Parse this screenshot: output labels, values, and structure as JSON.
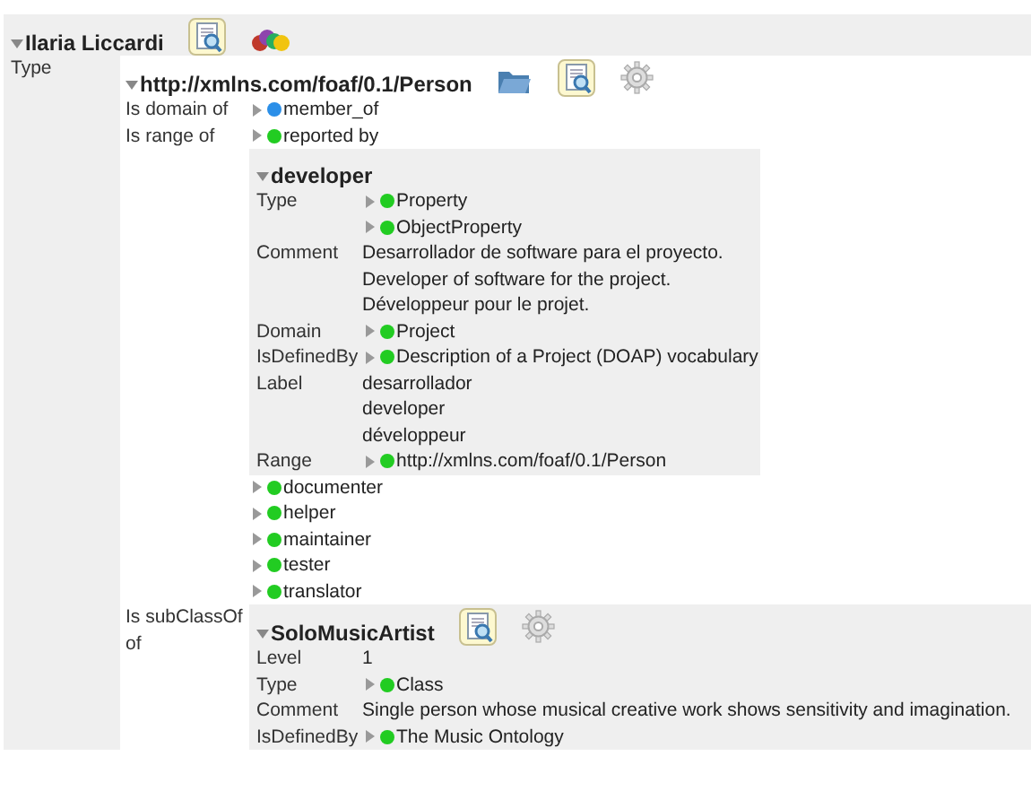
{
  "resource": {
    "title": "Ilaria Liccardi",
    "expanded": true,
    "inspect_button": true,
    "people_button": true,
    "rows": [
      {
        "label": "Type",
        "values": [
          {
            "kind": "resource",
            "title": "http://xmlns.com/foaf/0.1/Person",
            "expanded": true,
            "folder_button": true,
            "inspect_button": true,
            "settings_button": true,
            "rows": [
              {
                "label": "Is domain of",
                "values": [
                  {
                    "kind": "link",
                    "text": "member_of",
                    "expanded": false,
                    "color": "#2b8fe8"
                  }
                ]
              },
              {
                "label": "Is range of",
                "values": [
                  {
                    "kind": "link",
                    "text": "reported by",
                    "expanded": false,
                    "color": "#22cc22"
                  },
                  {
                    "kind": "resource",
                    "title": "developer",
                    "expanded": true,
                    "rows": [
                      {
                        "label": "Type",
                        "values": [
                          {
                            "kind": "link",
                            "text": "Property",
                            "expanded": false,
                            "color": "#22cc22"
                          },
                          {
                            "kind": "link",
                            "text": "ObjectProperty",
                            "expanded": false,
                            "color": "#22cc22"
                          }
                        ]
                      },
                      {
                        "label": "Comment",
                        "values": [
                          {
                            "kind": "text",
                            "text": "Desarrollador de software para el proyecto."
                          },
                          {
                            "kind": "text",
                            "text": "Developer of software for the project."
                          },
                          {
                            "kind": "text",
                            "text": "Développeur pour le projet."
                          }
                        ]
                      },
                      {
                        "label": "Domain",
                        "values": [
                          {
                            "kind": "link",
                            "text": "Project",
                            "expanded": false,
                            "color": "#22cc22"
                          }
                        ]
                      },
                      {
                        "label": "IsDefinedBy",
                        "values": [
                          {
                            "kind": "link",
                            "text": "Description of a Project (DOAP) vocabulary",
                            "expanded": false,
                            "color": "#22cc22"
                          }
                        ]
                      },
                      {
                        "label": "Label",
                        "values": [
                          {
                            "kind": "text",
                            "text": "desarrollador"
                          },
                          {
                            "kind": "text",
                            "text": "developer"
                          },
                          {
                            "kind": "text",
                            "text": "développeur"
                          }
                        ]
                      },
                      {
                        "label": "Range",
                        "values": [
                          {
                            "kind": "link",
                            "text": "http://xmlns.com/foaf/0.1/Person",
                            "expanded": false,
                            "color": "#22cc22"
                          }
                        ]
                      }
                    ]
                  },
                  {
                    "kind": "link",
                    "text": "documenter",
                    "expanded": false,
                    "color": "#22cc22"
                  },
                  {
                    "kind": "link",
                    "text": "helper",
                    "expanded": false,
                    "color": "#22cc22"
                  },
                  {
                    "kind": "link",
                    "text": "maintainer",
                    "expanded": false,
                    "color": "#22cc22"
                  },
                  {
                    "kind": "link",
                    "text": "tester",
                    "expanded": false,
                    "color": "#22cc22"
                  },
                  {
                    "kind": "link",
                    "text": "translator",
                    "expanded": false,
                    "color": "#22cc22"
                  }
                ]
              },
              {
                "label": "Is subClassOf of",
                "values": [
                  {
                    "kind": "resource",
                    "title": "SoloMusicArtist",
                    "expanded": true,
                    "inspect_button": true,
                    "settings_button": true,
                    "rows": [
                      {
                        "label": "Level",
                        "values": [
                          {
                            "kind": "text",
                            "text": "1"
                          }
                        ]
                      },
                      {
                        "label": "Type",
                        "values": [
                          {
                            "kind": "link",
                            "text": "Class",
                            "expanded": false,
                            "color": "#22cc22"
                          }
                        ]
                      },
                      {
                        "label": "Comment",
                        "values": [
                          {
                            "kind": "text",
                            "text": "Single person whose musical creative work shows sensitivity and imagination."
                          }
                        ]
                      },
                      {
                        "label": "IsDefinedBy",
                        "values": [
                          {
                            "kind": "link",
                            "text": "The Music Ontology",
                            "expanded": false,
                            "color": "#22cc22"
                          }
                        ]
                      }
                    ]
                  }
                ]
              }
            ]
          }
        ]
      }
    ]
  }
}
